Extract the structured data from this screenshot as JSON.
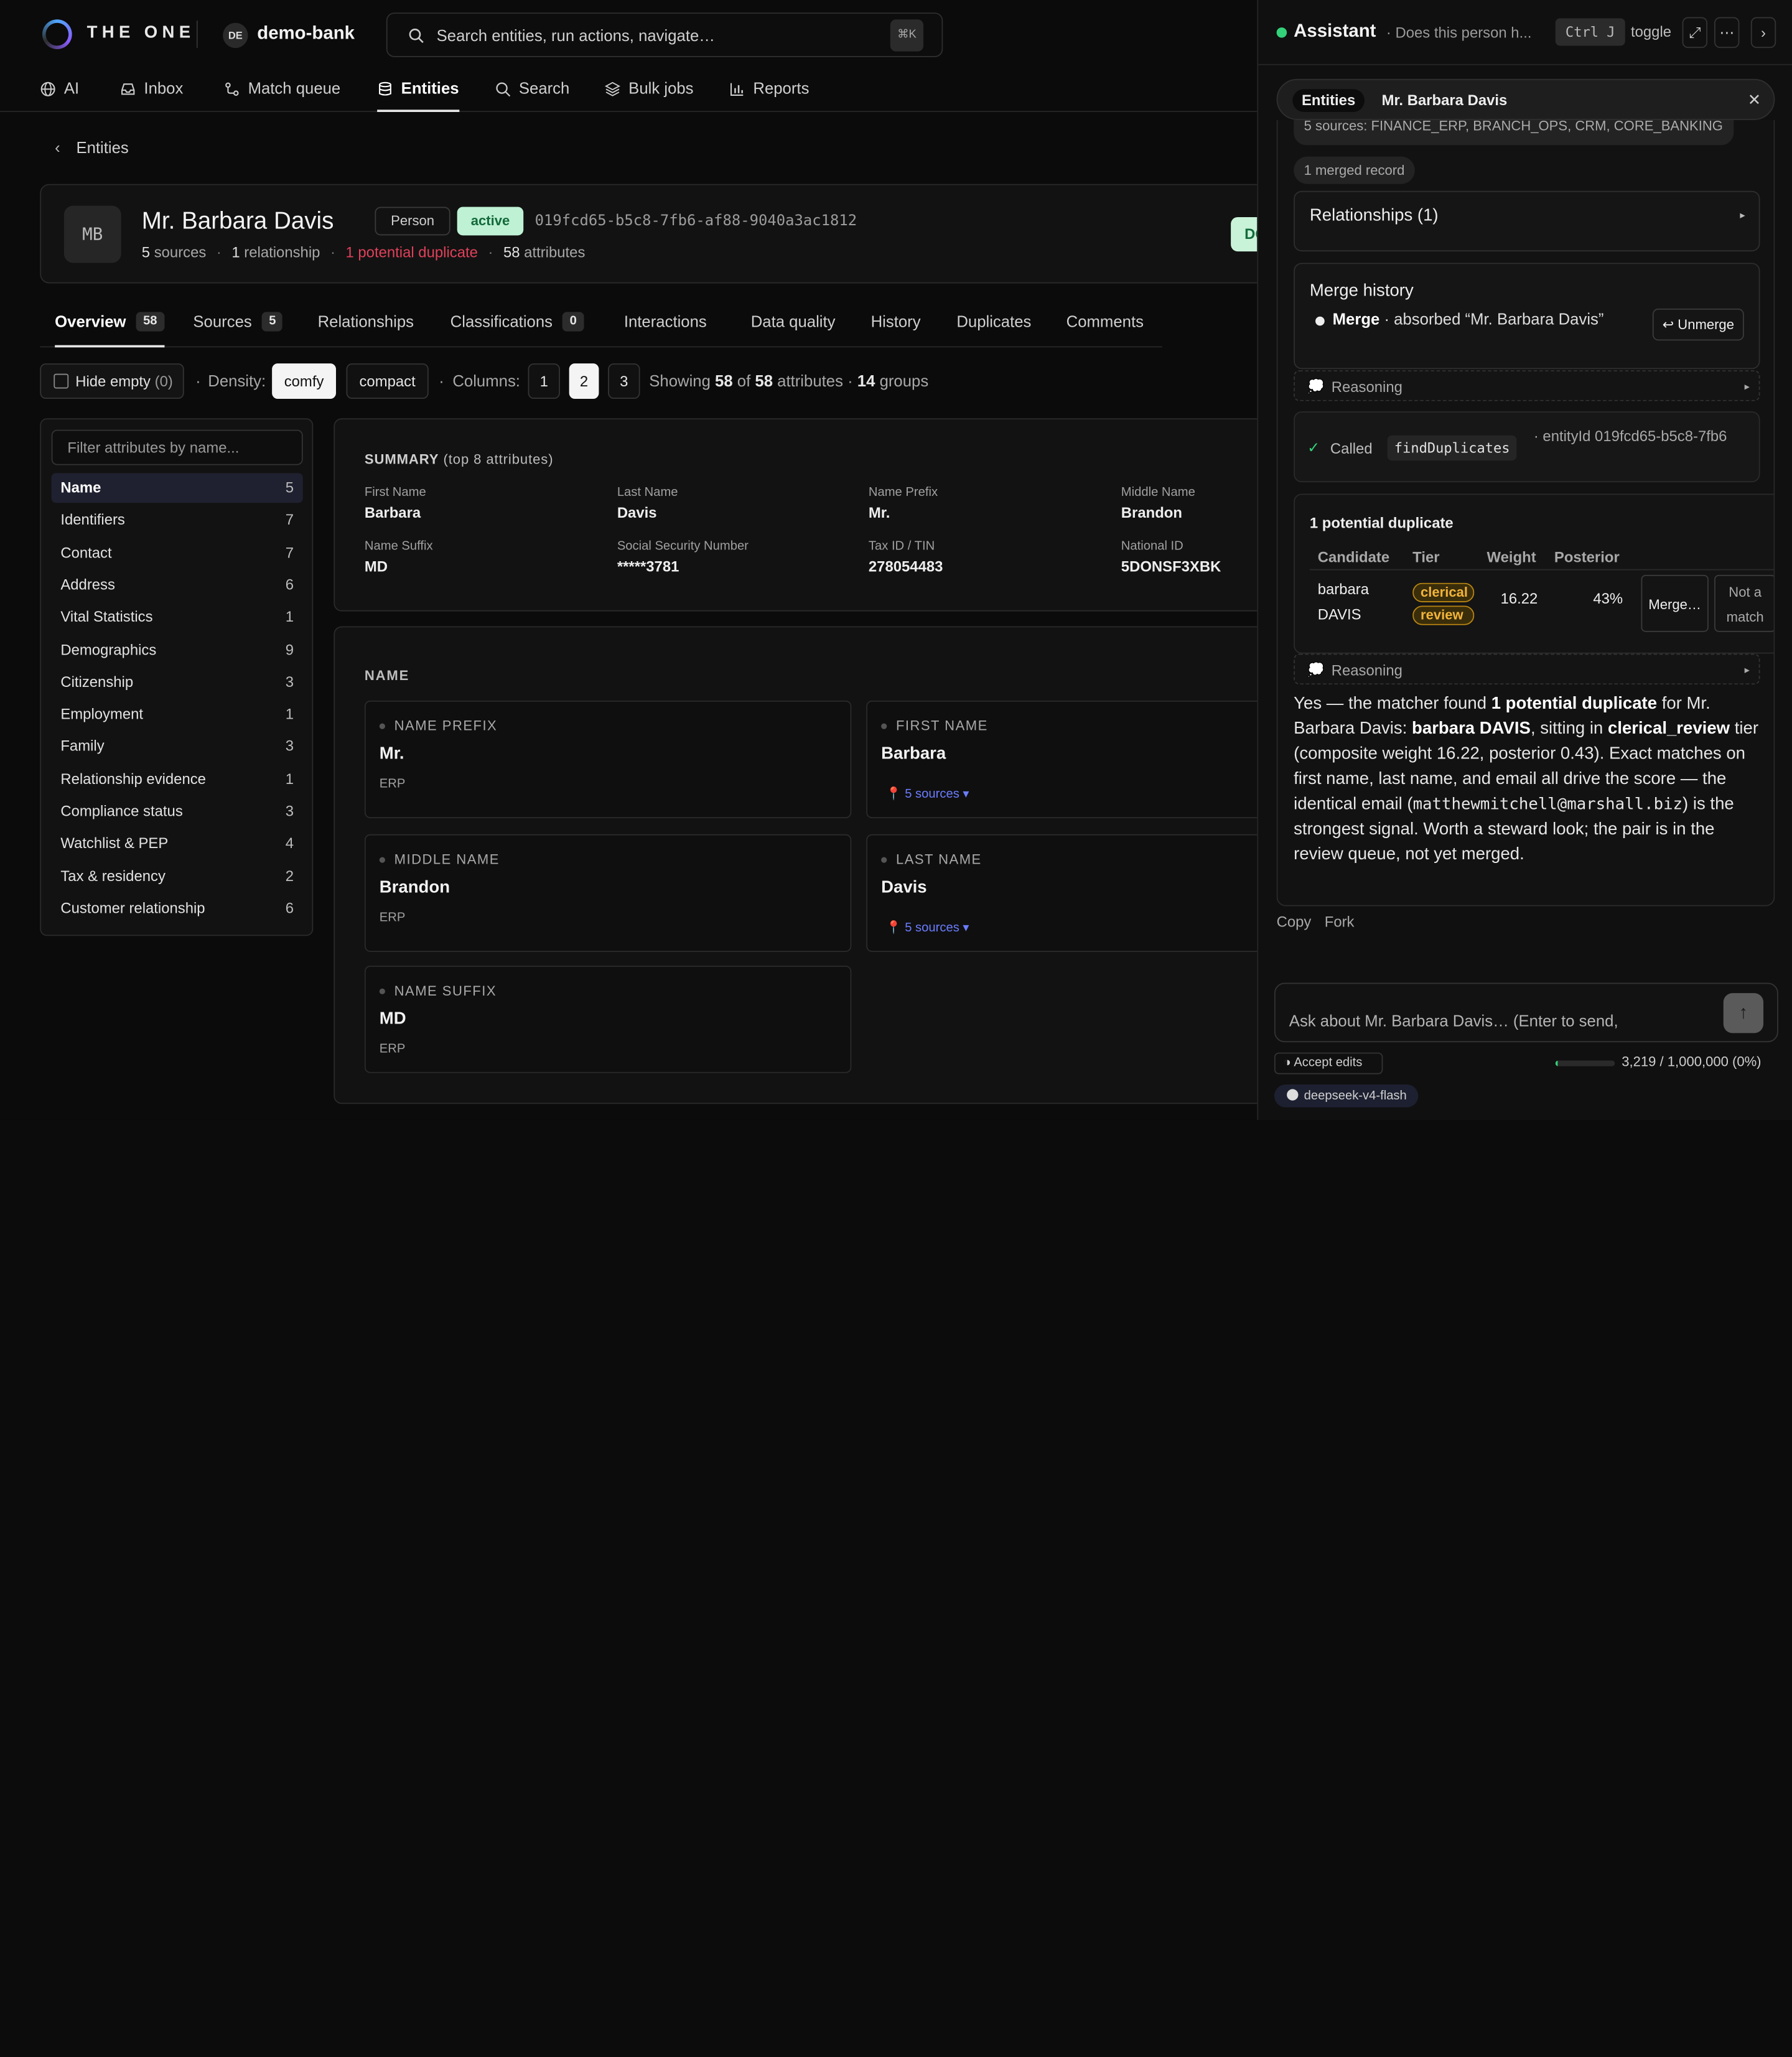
{
  "app": {
    "brand": "THE ONE",
    "workspace_initials": "DE",
    "workspace": "demo-bank"
  },
  "search": {
    "placeholder": "Search entities, run actions, navigate…",
    "shortcut": "⌘K"
  },
  "nav": [
    {
      "label": "AI",
      "icon": "globe-icon"
    },
    {
      "label": "Inbox",
      "icon": "inbox-icon"
    },
    {
      "label": "Match queue",
      "icon": "route-icon"
    },
    {
      "label": "Entities",
      "icon": "database-icon",
      "active": true
    },
    {
      "label": "Search",
      "icon": "search-icon"
    },
    {
      "label": "Bulk jobs",
      "icon": "layers-icon"
    },
    {
      "label": "Reports",
      "icon": "bar-chart-icon"
    }
  ],
  "breadcrumb": {
    "label": "Entities"
  },
  "entity": {
    "initials": "MB",
    "name": "Mr. Barbara Davis",
    "type": "Person",
    "status": "active",
    "id": "019fcd65-b5c8-7fb6-af88-9040a3ac1812",
    "sources_count": "5",
    "sources_label": "sources",
    "relationships_count": "1",
    "relationships_label": "relationship",
    "duplicates_label": "1 potential duplicate",
    "attributes_count": "58",
    "attributes_label": "attributes",
    "dq_button": "DQ"
  },
  "tabs": [
    {
      "label": "Overview",
      "count": "58",
      "active": true
    },
    {
      "label": "Sources",
      "count": "5"
    },
    {
      "label": "Relationships"
    },
    {
      "label": "Classifications",
      "count": "0"
    },
    {
      "label": "Interactions"
    },
    {
      "label": "Data quality"
    },
    {
      "label": "History"
    },
    {
      "label": "Duplicates"
    },
    {
      "label": "Comments"
    }
  ],
  "toolbar": {
    "hide_empty": "Hide empty",
    "hide_empty_count": "(0)",
    "density_label": "Density:",
    "density_options": [
      "comfy",
      "compact"
    ],
    "density_selected": "comfy",
    "columns_label": "Columns:",
    "columns_options": [
      "1",
      "2",
      "3"
    ],
    "columns_selected": "2",
    "showing_prefix": "Showing",
    "showing_count": "58",
    "showing_of": "of",
    "showing_total": "58",
    "showing_attrs": "attributes",
    "groups_count": "14",
    "groups_label": "groups"
  },
  "attr_nav": {
    "filter_placeholder": "Filter attributes by name...",
    "items": [
      {
        "label": "Name",
        "count": "5",
        "active": true
      },
      {
        "label": "Identifiers",
        "count": "7"
      },
      {
        "label": "Contact",
        "count": "7"
      },
      {
        "label": "Address",
        "count": "6"
      },
      {
        "label": "Vital Statistics",
        "count": "1"
      },
      {
        "label": "Demographics",
        "count": "9"
      },
      {
        "label": "Citizenship",
        "count": "3"
      },
      {
        "label": "Employment",
        "count": "1"
      },
      {
        "label": "Family",
        "count": "3"
      },
      {
        "label": "Relationship evidence",
        "count": "1"
      },
      {
        "label": "Compliance status",
        "count": "3"
      },
      {
        "label": "Watchlist & PEP",
        "count": "4"
      },
      {
        "label": "Tax & residency",
        "count": "2"
      },
      {
        "label": "Customer relationship",
        "count": "6"
      }
    ]
  },
  "summary": {
    "title": "SUMMARY",
    "subtitle": "(top 8 attributes)",
    "fields": [
      {
        "label": "First Name",
        "value": "Barbara"
      },
      {
        "label": "Last Name",
        "value": "Davis"
      },
      {
        "label": "Name Prefix",
        "value": "Mr."
      },
      {
        "label": "Middle Name",
        "value": "Brandon"
      },
      {
        "label": "Name Suffix",
        "value": "MD"
      },
      {
        "label": "Social Security Number",
        "value": "*****3781"
      },
      {
        "label": "Tax ID / TIN",
        "value": "278054483"
      },
      {
        "label": "National ID",
        "value": "5DONSF3XBK"
      }
    ]
  },
  "name_section": {
    "title": "NAME",
    "attrs": [
      {
        "label": "NAME PREFIX",
        "value": "Mr.",
        "source": "ERP"
      },
      {
        "label": "FIRST NAME",
        "value": "Barbara",
        "source": "📍 5 sources ▾"
      },
      {
        "label": "MIDDLE NAME",
        "value": "Brandon",
        "source": "ERP"
      },
      {
        "label": "LAST NAME",
        "value": "Davis",
        "source": "📍 5 sources ▾"
      },
      {
        "label": "NAME SUFFIX",
        "value": "MD",
        "source": "ERP"
      }
    ]
  },
  "assistant": {
    "title": "Assistant",
    "subtitle": "· Does this person h...",
    "shortcut": "Ctrl J",
    "toggle_label": "toggle",
    "context_label": "Entities",
    "context_name": "Mr. Barbara Davis",
    "chips": {
      "sources": "5 sources: FINANCE_ERP, BRANCH_OPS, CRM, CORE_BANKING",
      "merged": "1 merged record"
    },
    "relationships": "Relationships (1)",
    "merge_history": {
      "title": "Merge history",
      "action": "Merge",
      "detail": "· absorbed “Mr. Barbara Davis”",
      "unmerge": "↩ Unmerge"
    },
    "reasoning_label": "Reasoning",
    "tool_call": {
      "called": "Called",
      "function": "findDuplicates",
      "args": "· entityId 019fcd65-b5c8-7fb6"
    },
    "duplicates": {
      "title": "1 potential duplicate",
      "headers": [
        "Candidate",
        "Tier",
        "Weight",
        "Posterior"
      ],
      "rows": [
        {
          "candidate_line1": "barbara",
          "candidate_line2": "DAVIS",
          "tier_line1": "clerical",
          "tier_line2": "review",
          "weight": "16.22",
          "posterior": "43%",
          "merge_label": "Merge…",
          "not_match_line1": "Not a",
          "not_match_line2": "match"
        }
      ]
    },
    "answer": {
      "p1": "Yes — the matcher found",
      "b1": "1 potential duplicate",
      "p2": "for Mr. Barbara Davis:",
      "b2": "barbara DAVIS",
      "p3": ", sitting in",
      "b3": "clerical_review",
      "p4": "tier (composite weight 16.22, posterior 0.43). Exact matches on first name, last name, and email all drive the score — the identical email (",
      "email": "matthewmitchell@marshall.biz",
      "p5": ") is the strongest signal. Worth a steward look; the pair is in the review queue, not yet merged."
    },
    "actions": {
      "copy": "Copy",
      "fork": "Fork"
    },
    "input_placeholder": "Ask about Mr. Barbara Davis… (Enter to send,",
    "accept_edits": "◑ Accept edits",
    "usage": "3,219 / 1,000,000 (0%)",
    "usage_fraction": 0.003219,
    "model": "deepseek-v4-flash"
  }
}
